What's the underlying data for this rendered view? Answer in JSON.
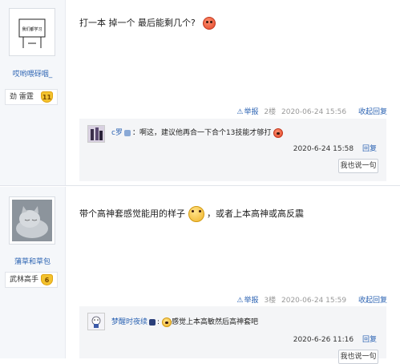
{
  "posts": [
    {
      "author": "哎哟喂砑咽_",
      "avatar_label": "我们都学习",
      "rank": "劲 雷霆",
      "level": "11",
      "content": "打一本 掉一个 最后能剩几个?",
      "report": "举报",
      "floor": "2楼",
      "time": "2020-06-24 15:56",
      "reply": "收起回复",
      "sub_replies": [
        {
          "who": "c罗",
          "text": "：啊这，建议他再合一下合个13技能才够打",
          "date": "2020-6-24 15:58",
          "reply": "回复"
        }
      ],
      "say_button": "我也说一句"
    },
    {
      "author": "蒲草和草包",
      "rank": "武林高手",
      "level": "6",
      "content_a": "带个高神套感觉能用的样子",
      "content_b": "，或者上本高神或高反震",
      "report": "举报",
      "floor": "3楼",
      "time": "2020-06-24 15:59",
      "reply": "收起回复",
      "sub_replies": [
        {
          "who": "梦醒时夜续",
          "text": ":",
          "text_b": "感觉上本高敏然后高神套吧",
          "date": "2020-6-26 11:16",
          "reply": "回复"
        }
      ],
      "say_button": "我也说一句"
    }
  ],
  "colors": {
    "link": "#2d64b3",
    "sidebar": "#f5f7fa",
    "subbox": "#f4f5f7"
  },
  "icons": [
    "warning-icon",
    "smiley-angry-icon",
    "smiley-wink-icon",
    "level-badge-icon"
  ]
}
